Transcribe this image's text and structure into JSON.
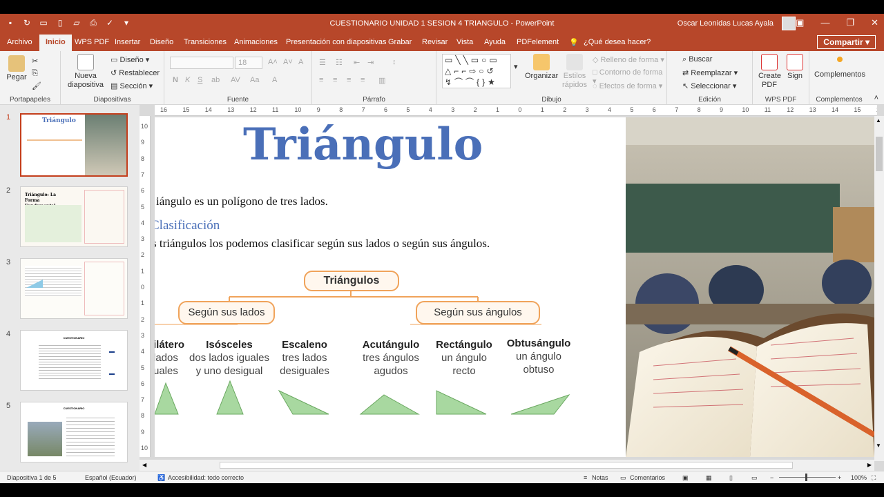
{
  "window": {
    "title": "CUESTIONARIO UNIDAD 1 SESION 4 TRIANGULO  -  PowerPoint",
    "user": "Oscar Leonidas Lucas Ayala",
    "share": "Compartir"
  },
  "tabs": [
    "Archivo",
    "Inicio",
    "WPS PDF",
    "Insertar",
    "Diseño",
    "Transiciones",
    "Animaciones",
    "Presentación con diapositivas",
    "Grabar",
    "Revisar",
    "Vista",
    "Ayuda",
    "PDFelement",
    "¿Qué desea hacer?"
  ],
  "ribbon": {
    "portapapeles": {
      "label": "Portapapeles",
      "pegar": "Pegar"
    },
    "diapositivas": {
      "label": "Diapositivas",
      "nueva": "Nueva",
      "nueva2": "diapositiva",
      "diseno": "Diseño",
      "restablecer": "Restablecer",
      "seccion": "Sección"
    },
    "fuente": {
      "label": "Fuente",
      "size": "18",
      "b": "N",
      "i": "K",
      "s": "S"
    },
    "parrafo": {
      "label": "Párrafo"
    },
    "dibujo": {
      "label": "Dibujo",
      "organizar": "Organizar",
      "estilos": "Estilos",
      "estilos2": "rápidos",
      "relleno": "Relleno de forma",
      "contorno": "Contorno de forma",
      "efectos": "Efectos de forma"
    },
    "edicion": {
      "label": "Edición",
      "buscar": "Buscar",
      "reemplazar": "Reemplazar",
      "seleccionar": "Seleccionar"
    },
    "wps": {
      "label": "WPS PDF",
      "create": "Create",
      "create2": "PDF",
      "sign": "Sign"
    },
    "complementos": {
      "label": "Complementos",
      "button": "Complementos"
    }
  },
  "thumbnails": [
    {
      "num": "1",
      "title": "Triángulo"
    },
    {
      "num": "2",
      "title": "Triángulo: La Forma Fundamental"
    },
    {
      "num": "3",
      "title": ""
    },
    {
      "num": "4",
      "title": "CUESTIONARIO"
    },
    {
      "num": "5",
      "title": "CUESTIONARIO"
    }
  ],
  "ruler": {
    "h": [
      "16",
      "15",
      "14",
      "13",
      "12",
      "11",
      "10",
      "9",
      "8",
      "7",
      "6",
      "5",
      "4",
      "3",
      "2",
      "1",
      "0",
      "1",
      "2",
      "3",
      "4",
      "5",
      "6",
      "7",
      "8",
      "9",
      "10",
      "11",
      "12",
      "13",
      "14",
      "15",
      "16"
    ],
    "v": [
      "10",
      "9",
      "8",
      "7",
      "6",
      "5",
      "4",
      "3",
      "2",
      "1",
      "0",
      "1",
      "2",
      "3",
      "4",
      "5",
      "6",
      "7",
      "8",
      "9",
      "10"
    ]
  },
  "slide": {
    "title": "Triángulo",
    "definition": "iángulo es un polígono de tres lados.",
    "clasificacion": "Clasificación",
    "desc": "s triángulos los podemos clasificar según sus lados o según sus ángulos.",
    "root": "Triángulos",
    "lados": "Según sus lados",
    "angulos": "Según sus ángulos",
    "types": [
      {
        "name": "ilátero",
        "d1": "lados",
        "d2": "uales"
      },
      {
        "name": "Isósceles",
        "d1": "dos lados iguales",
        "d2": "y uno desigual"
      },
      {
        "name": "Escaleno",
        "d1": "tres lados",
        "d2": "desiguales"
      },
      {
        "name": "Acutángulo",
        "d1": "tres ángulos",
        "d2": "agudos"
      },
      {
        "name": "Rectángulo",
        "d1": "un ángulo",
        "d2": "recto"
      },
      {
        "name": "Obtusángulo",
        "d1": "un ángulo",
        "d2": "obtuso"
      }
    ]
  },
  "status": {
    "slide": "Diapositiva 1 de 5",
    "lang": "Español (Ecuador)",
    "access": "Accesibilidad: todo correcto",
    "notes": "Notas",
    "comments": "Comentarios",
    "zoom": "100%"
  },
  "colors": {
    "accent": "#b7472a",
    "title": "#4a6fb8",
    "box": "#f0a35a",
    "tri": "#a8d8a0"
  }
}
